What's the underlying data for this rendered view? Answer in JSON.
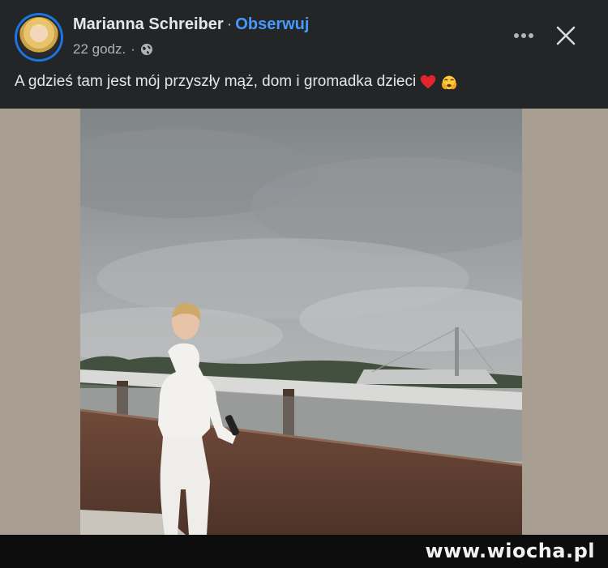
{
  "post": {
    "author": "Marianna Schreiber",
    "separator": "·",
    "follow_label": "Obserwuj",
    "time": "22 godz.",
    "meta_separator": "·",
    "audience_icon": "globe-icon",
    "caption": "A gdzieś tam jest mój przyszły mąż, dom i gromadka dzieci",
    "caption_emojis": [
      "heart-emoji",
      "hands-holding-face-emoji"
    ]
  },
  "actions": {
    "more_icon": "more-icon",
    "close_icon": "close-icon"
  },
  "photo": {
    "description_icon": "post-photo"
  },
  "watermark": "www.wiocha.pl",
  "colors": {
    "background": "#242526",
    "text": "#e4e6eb",
    "muted": "#b0b3b8",
    "link": "#4599ff",
    "avatar_ring": "#1b74e4"
  }
}
